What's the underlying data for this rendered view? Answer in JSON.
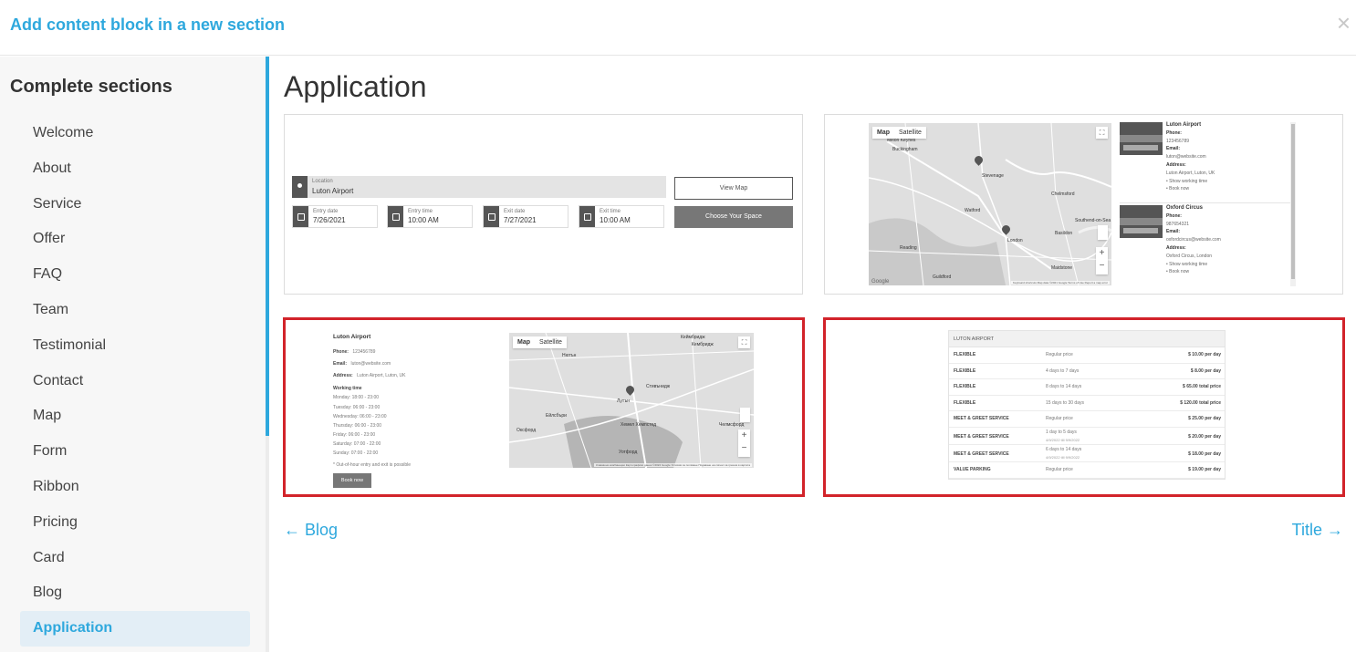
{
  "dialog": {
    "title": "Add content block in a new section",
    "close_glyph": "×"
  },
  "sidebar": {
    "heading": "Complete sections",
    "items": [
      {
        "label": "Welcome"
      },
      {
        "label": "About"
      },
      {
        "label": "Service"
      },
      {
        "label": "Offer"
      },
      {
        "label": "FAQ"
      },
      {
        "label": "Team"
      },
      {
        "label": "Testimonial"
      },
      {
        "label": "Contact"
      },
      {
        "label": "Map"
      },
      {
        "label": "Form"
      },
      {
        "label": "Ribbon"
      },
      {
        "label": "Pricing"
      },
      {
        "label": "Card"
      },
      {
        "label": "Blog"
      },
      {
        "label": "Application"
      }
    ],
    "active": "Application"
  },
  "main": {
    "title": "Application"
  },
  "card1": {
    "location_label": "Location",
    "location_value": "Luton Airport",
    "entry_date_label": "Entry date",
    "entry_date_value": "7/26/2021",
    "entry_time_label": "Entry time",
    "entry_time_value": "10:00 AM",
    "exit_date_label": "Exit date",
    "exit_date_value": "7/27/2021",
    "exit_time_label": "Exit time",
    "exit_time_value": "10:00 AM",
    "view_map": "View Map",
    "choose_space": "Choose Your Space"
  },
  "card2": {
    "map_tab": "Map",
    "satellite_tab": "Satellite",
    "cities": [
      "Milton Keynes",
      "Buckingham",
      "Stevenage",
      "Chelmsford",
      "Watford",
      "London",
      "Reading",
      "Guildford",
      "Southend-on-Sea",
      "Maidstone",
      "Basildon"
    ],
    "google": "Google",
    "attribution": "Keyboard shortcuts   Map data ©2021 Google   Terms of Use   Report a map error",
    "locations": [
      {
        "name": "Luton Airport",
        "phone_label": "Phone:",
        "phone": "123456789",
        "email_label": "Email:",
        "email": "luton@website.com",
        "address_label": "Address:",
        "address": "Luton Airport, Luton, UK",
        "show_time": "• Show working time",
        "book": "• Book now"
      },
      {
        "name": "Oxford Circus",
        "phone_label": "Phone:",
        "phone": "987654321",
        "email_label": "Email:",
        "email": "oxfordcircus@website.com",
        "address_label": "Address:",
        "address": "Oxford Circus, London",
        "show_time": "• Show working time",
        "book": "• Book now"
      }
    ]
  },
  "card3": {
    "name": "Luton Airport",
    "phone_label": "Phone:",
    "phone": "123456789",
    "email_label": "Email:",
    "email": "luton@website.com",
    "address_label": "Address:",
    "address": "Luton Airport, Luton, UK",
    "working_time": "Working time",
    "hours": [
      "Monday: 18:00 - 23:00",
      "Tuesday: 06:00 - 23:00",
      "Wednesday: 06:00 - 23:00",
      "Thursday: 06:00 - 23:00",
      "Friday: 06:00 - 23:00",
      "Saturday: 07:00 - 22:00",
      "Sunday: 07:00 - 22:00"
    ],
    "note": "* Out-of-hour entry and exit is possible",
    "book": "Book now",
    "map_tab": "Map",
    "satellite_tab": "Satellite",
    "cities": [
      "Кеймбридж",
      "Кембридж",
      "Лутън",
      "Стивънидж",
      "Ейлсбъри",
      "Уотфорд",
      "Хемел Хемпстед",
      "Челмсфорд",
      "Оксфорд",
      "Нютън"
    ],
    "attribution": "Клавишни комбинации   Картографски данни ©2022 Google   Условия за ползване   Подаване на сигнал за грешка в картата"
  },
  "card4": {
    "header": "LUTON AIRPORT",
    "rows": [
      {
        "name": "FLEXIBLE",
        "desc": "Regular price",
        "sub": "",
        "price": "$ 10.00 per day"
      },
      {
        "name": "FLEXIBLE",
        "desc": "4 days to 7 days",
        "sub": "",
        "price": "$ 8.00 per day"
      },
      {
        "name": "FLEXIBLE",
        "desc": "8 days to 14 days",
        "sub": "",
        "price": "$ 65.00 total price"
      },
      {
        "name": "FLEXIBLE",
        "desc": "15 days to 30 days",
        "sub": "",
        "price": "$ 120.00 total price"
      },
      {
        "name": "MEET & GREET SERVICE",
        "desc": "Regular price",
        "sub": "",
        "price": "$ 25.00 per day"
      },
      {
        "name": "MEET & GREET SERVICE",
        "desc": "1 day to 5 days",
        "sub": "4/9/2022 till 9/9/2022",
        "price": "$ 20.00 per day"
      },
      {
        "name": "MEET & GREET SERVICE",
        "desc": "6 days to 14 days",
        "sub": "4/9/2022 till 9/9/2022",
        "price": "$ 18.00 per day"
      },
      {
        "name": "VALUE PARKING",
        "desc": "Regular price",
        "sub": "",
        "price": "$ 19.00 per day"
      }
    ]
  },
  "nav": {
    "prev": "← Blog",
    "next": "Title →"
  },
  "colors": {
    "accent": "#2ea8dd",
    "selection": "#d2232a",
    "active_bg": "#e3eef6"
  }
}
